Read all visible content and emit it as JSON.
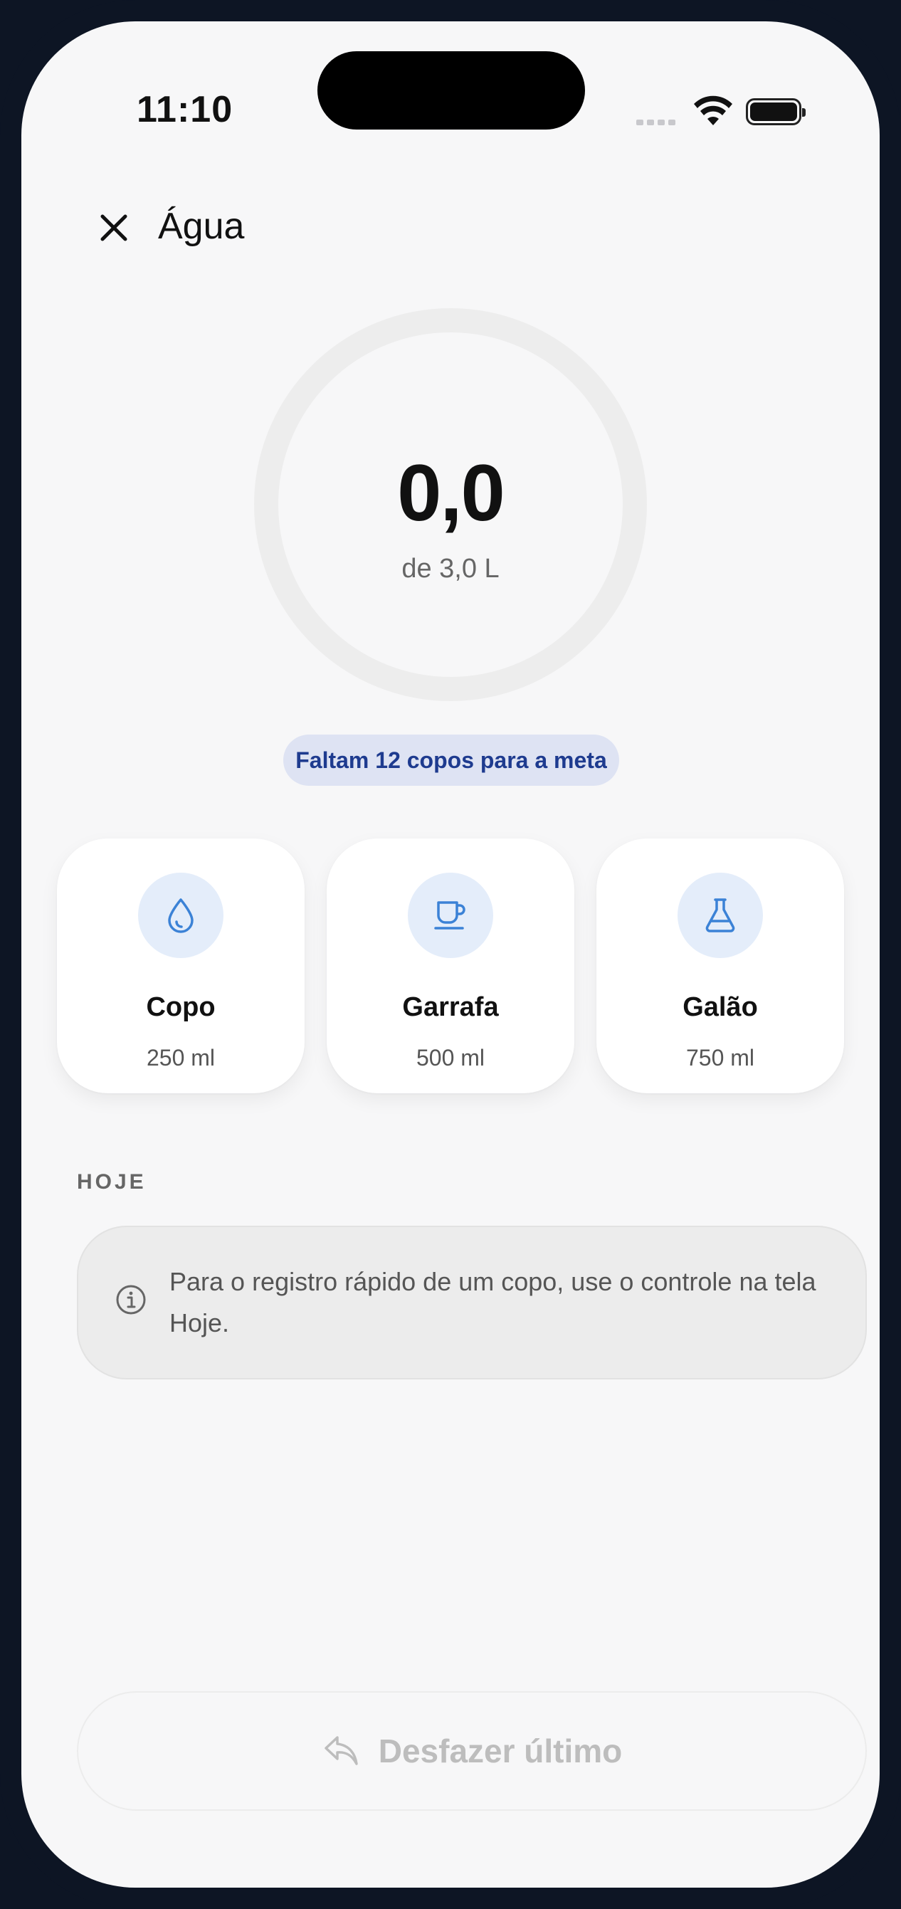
{
  "status_bar": {
    "time": "11:10"
  },
  "header": {
    "title": "Água"
  },
  "progress": {
    "value": "0,0",
    "subtitle": "de 3,0 L",
    "fraction": 0.0
  },
  "goal_pill": "Faltam 12 copos para a meta",
  "containers": [
    {
      "name": "Copo",
      "volume": "250 ml",
      "icon": "drop-icon"
    },
    {
      "name": "Garrafa",
      "volume": "500 ml",
      "icon": "cup-icon"
    },
    {
      "name": "Galão",
      "volume": "750 ml",
      "icon": "flask-icon"
    }
  ],
  "today": {
    "section_label": "HOJE",
    "info_text": "Para o registro rápido de um copo, use o controle na tela Hoje."
  },
  "undo_button": {
    "label": "Desfazer último"
  },
  "colors": {
    "accent": "#3b82d6",
    "pill_bg": "#dee3f3",
    "pill_text": "#1e3b8f",
    "icon_bg": "#e4edfa"
  }
}
